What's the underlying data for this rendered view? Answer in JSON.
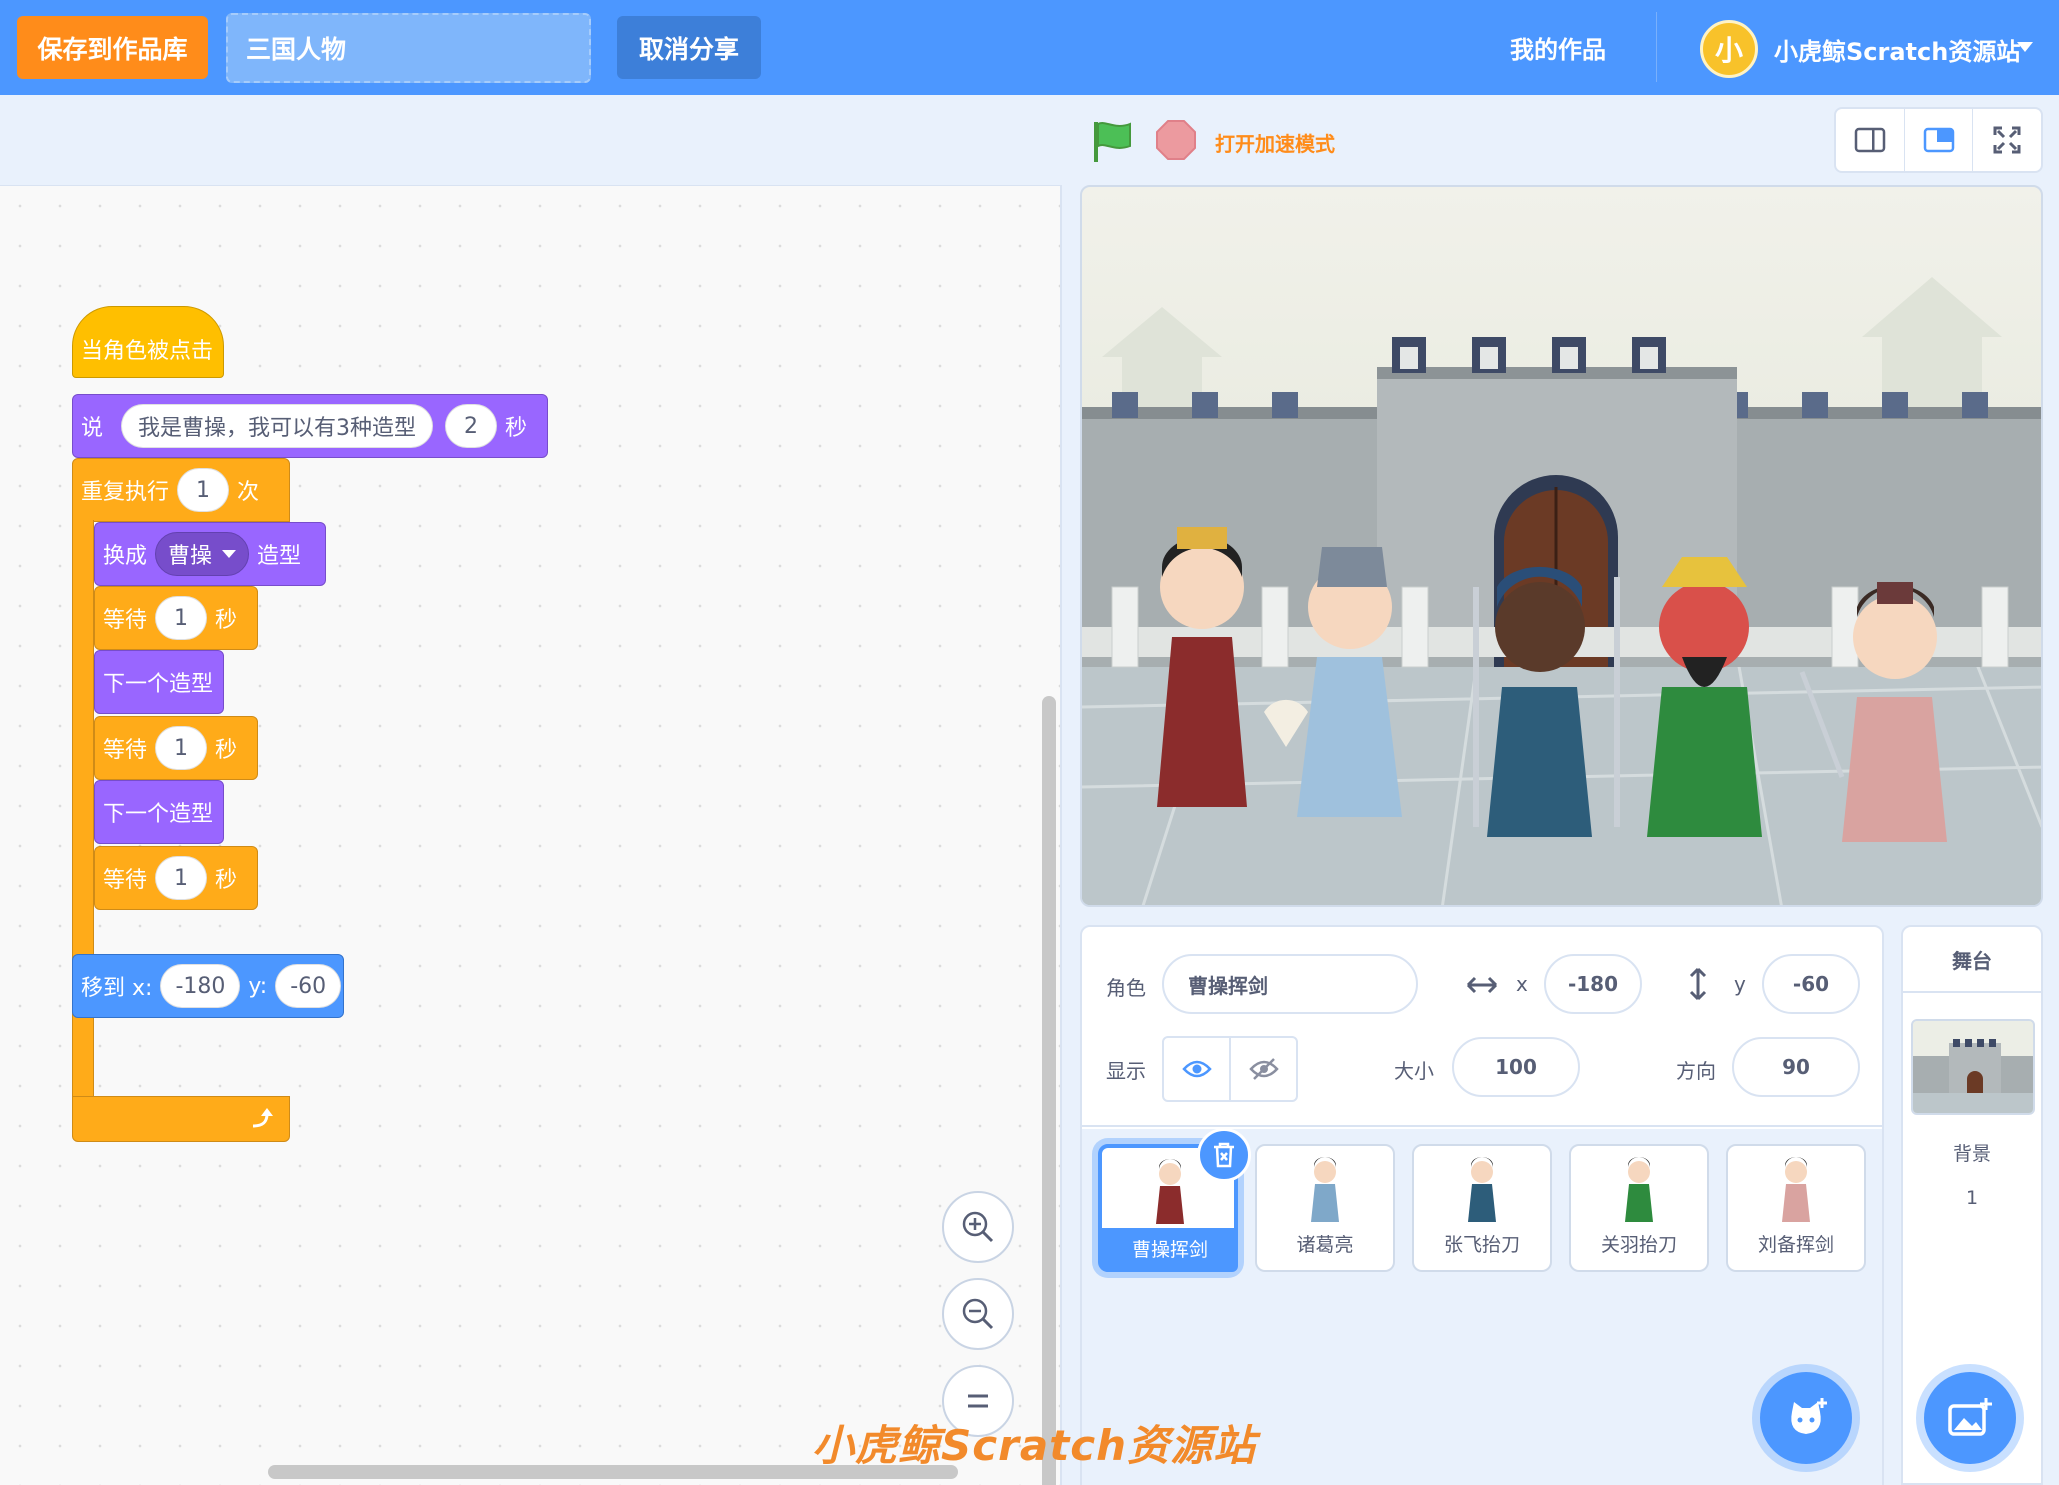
{
  "menu": {
    "save_label": "保存到作品库",
    "project_title": "三国人物",
    "unshare_label": "取消分享",
    "my_works_label": "我的作品",
    "account_logo_text": "小",
    "account_name": "小虎鲸Scratch资源站"
  },
  "stage_controls": {
    "turbo_label": "打开加速模式"
  },
  "code": {
    "hat_label": "当角色被点击",
    "say_label": "说",
    "say_text": "我是曹操，我可以有3种造型",
    "say_secs": "2",
    "say_unit": "秒",
    "repeat_label": "重复执行",
    "repeat_times": "1",
    "repeat_unit": "次",
    "switch_label": "换成",
    "costume_name": "曹操",
    "switch_suffix": "造型",
    "wait_label": "等待",
    "wait_secs": "1",
    "wait_unit": "秒",
    "next_costume_label": "下一个造型",
    "goto_label": "移到 x:",
    "goto_x": "-180",
    "goto_y_label": "y:",
    "goto_y": "-60"
  },
  "sprite_info": {
    "sprite_label": "角色",
    "sprite_name": "曹操挥剑",
    "x_label": "x",
    "x_value": "-180",
    "y_label": "y",
    "y_value": "-60",
    "show_label": "显示",
    "size_label": "大小",
    "size_value": "100",
    "direction_label": "方向",
    "direction_value": "90"
  },
  "sprites": [
    {
      "name": "曹操挥剑",
      "selected": true,
      "color": "#8b2c2c"
    },
    {
      "name": "诸葛亮",
      "selected": false,
      "color": "#7fa8c9"
    },
    {
      "name": "张飞抬刀",
      "selected": false,
      "color": "#2d5d7a"
    },
    {
      "name": "关羽抬刀",
      "selected": false,
      "color": "#2e8b3e"
    },
    {
      "name": "刘备挥剑",
      "selected": false,
      "color": "#d9a3a0"
    }
  ],
  "stage_selector": {
    "title": "舞台",
    "backdrop_label": "背景",
    "backdrop_count": "1"
  },
  "icons": {
    "flag": "green-flag-icon",
    "stop": "stop-icon",
    "small_stage": "small-stage-icon",
    "normal_stage": "normal-stage-icon",
    "fullscreen": "fullscreen-icon",
    "zoom_in": "zoom-in-icon",
    "zoom_out": "zoom-out-icon",
    "zoom_reset": "zoom-reset-icon",
    "show": "eye-icon",
    "hide": "eye-slash-icon",
    "delete": "trash-icon",
    "add_sprite": "add-sprite-icon",
    "add_backdrop": "add-backdrop-icon"
  },
  "colors": {
    "menu_bg": "#4c97ff",
    "save_button": "#ff8c1a",
    "events": "#ffbf00",
    "looks": "#9966ff",
    "control": "#ffab19",
    "motion": "#4c97ff"
  },
  "watermark": "小虎鲸Scratch资源站"
}
